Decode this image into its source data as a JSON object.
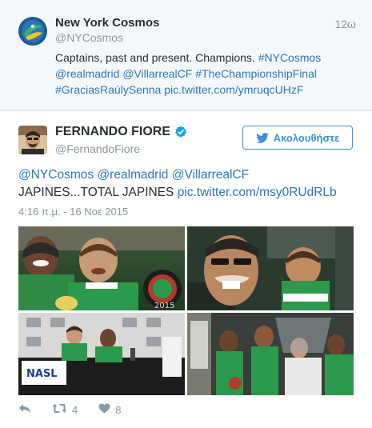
{
  "retweet": {
    "name": "New York Cosmos",
    "handle": "@NYCosmos",
    "time": "12ω",
    "text_plain_1": "Captains, past and present. Champions. ",
    "link_1": "#NYCosmos",
    "link_2": "@realmadrid",
    "link_3": "@VillarrealCF",
    "link_4": "#TheChampionshipFinal",
    "link_5": "#GraciasRaúlySenna",
    "link_6": "pic.twitter.com/ymruqcUHzF"
  },
  "tweet": {
    "name": "FERNANDO FIORE",
    "handle": "@FernandoFiore",
    "follow_label": "Ακολουθήστε",
    "mention_1": "@NYCosmos",
    "mention_2": "@realmadrid",
    "mention_3": "@VillarrealCF",
    "text_plain": "JAPINES...TOTAL JAPINES ",
    "pic_link": "pic.twitter.com/msy0RUdRLb",
    "date": "4:16 π.μ. - 16 Νοε 2015",
    "retweet_count": "4",
    "like_count": "8"
  },
  "colors": {
    "link": "#2b7bb9",
    "follow": "#3b94d9",
    "muted": "#8899a6",
    "verified": "#1da1f2"
  },
  "icons": {
    "reply": "reply-icon",
    "retweet": "retweet-icon",
    "like": "heart-icon",
    "follow": "twitter-bird-icon",
    "verified": "verified-badge-icon"
  }
}
